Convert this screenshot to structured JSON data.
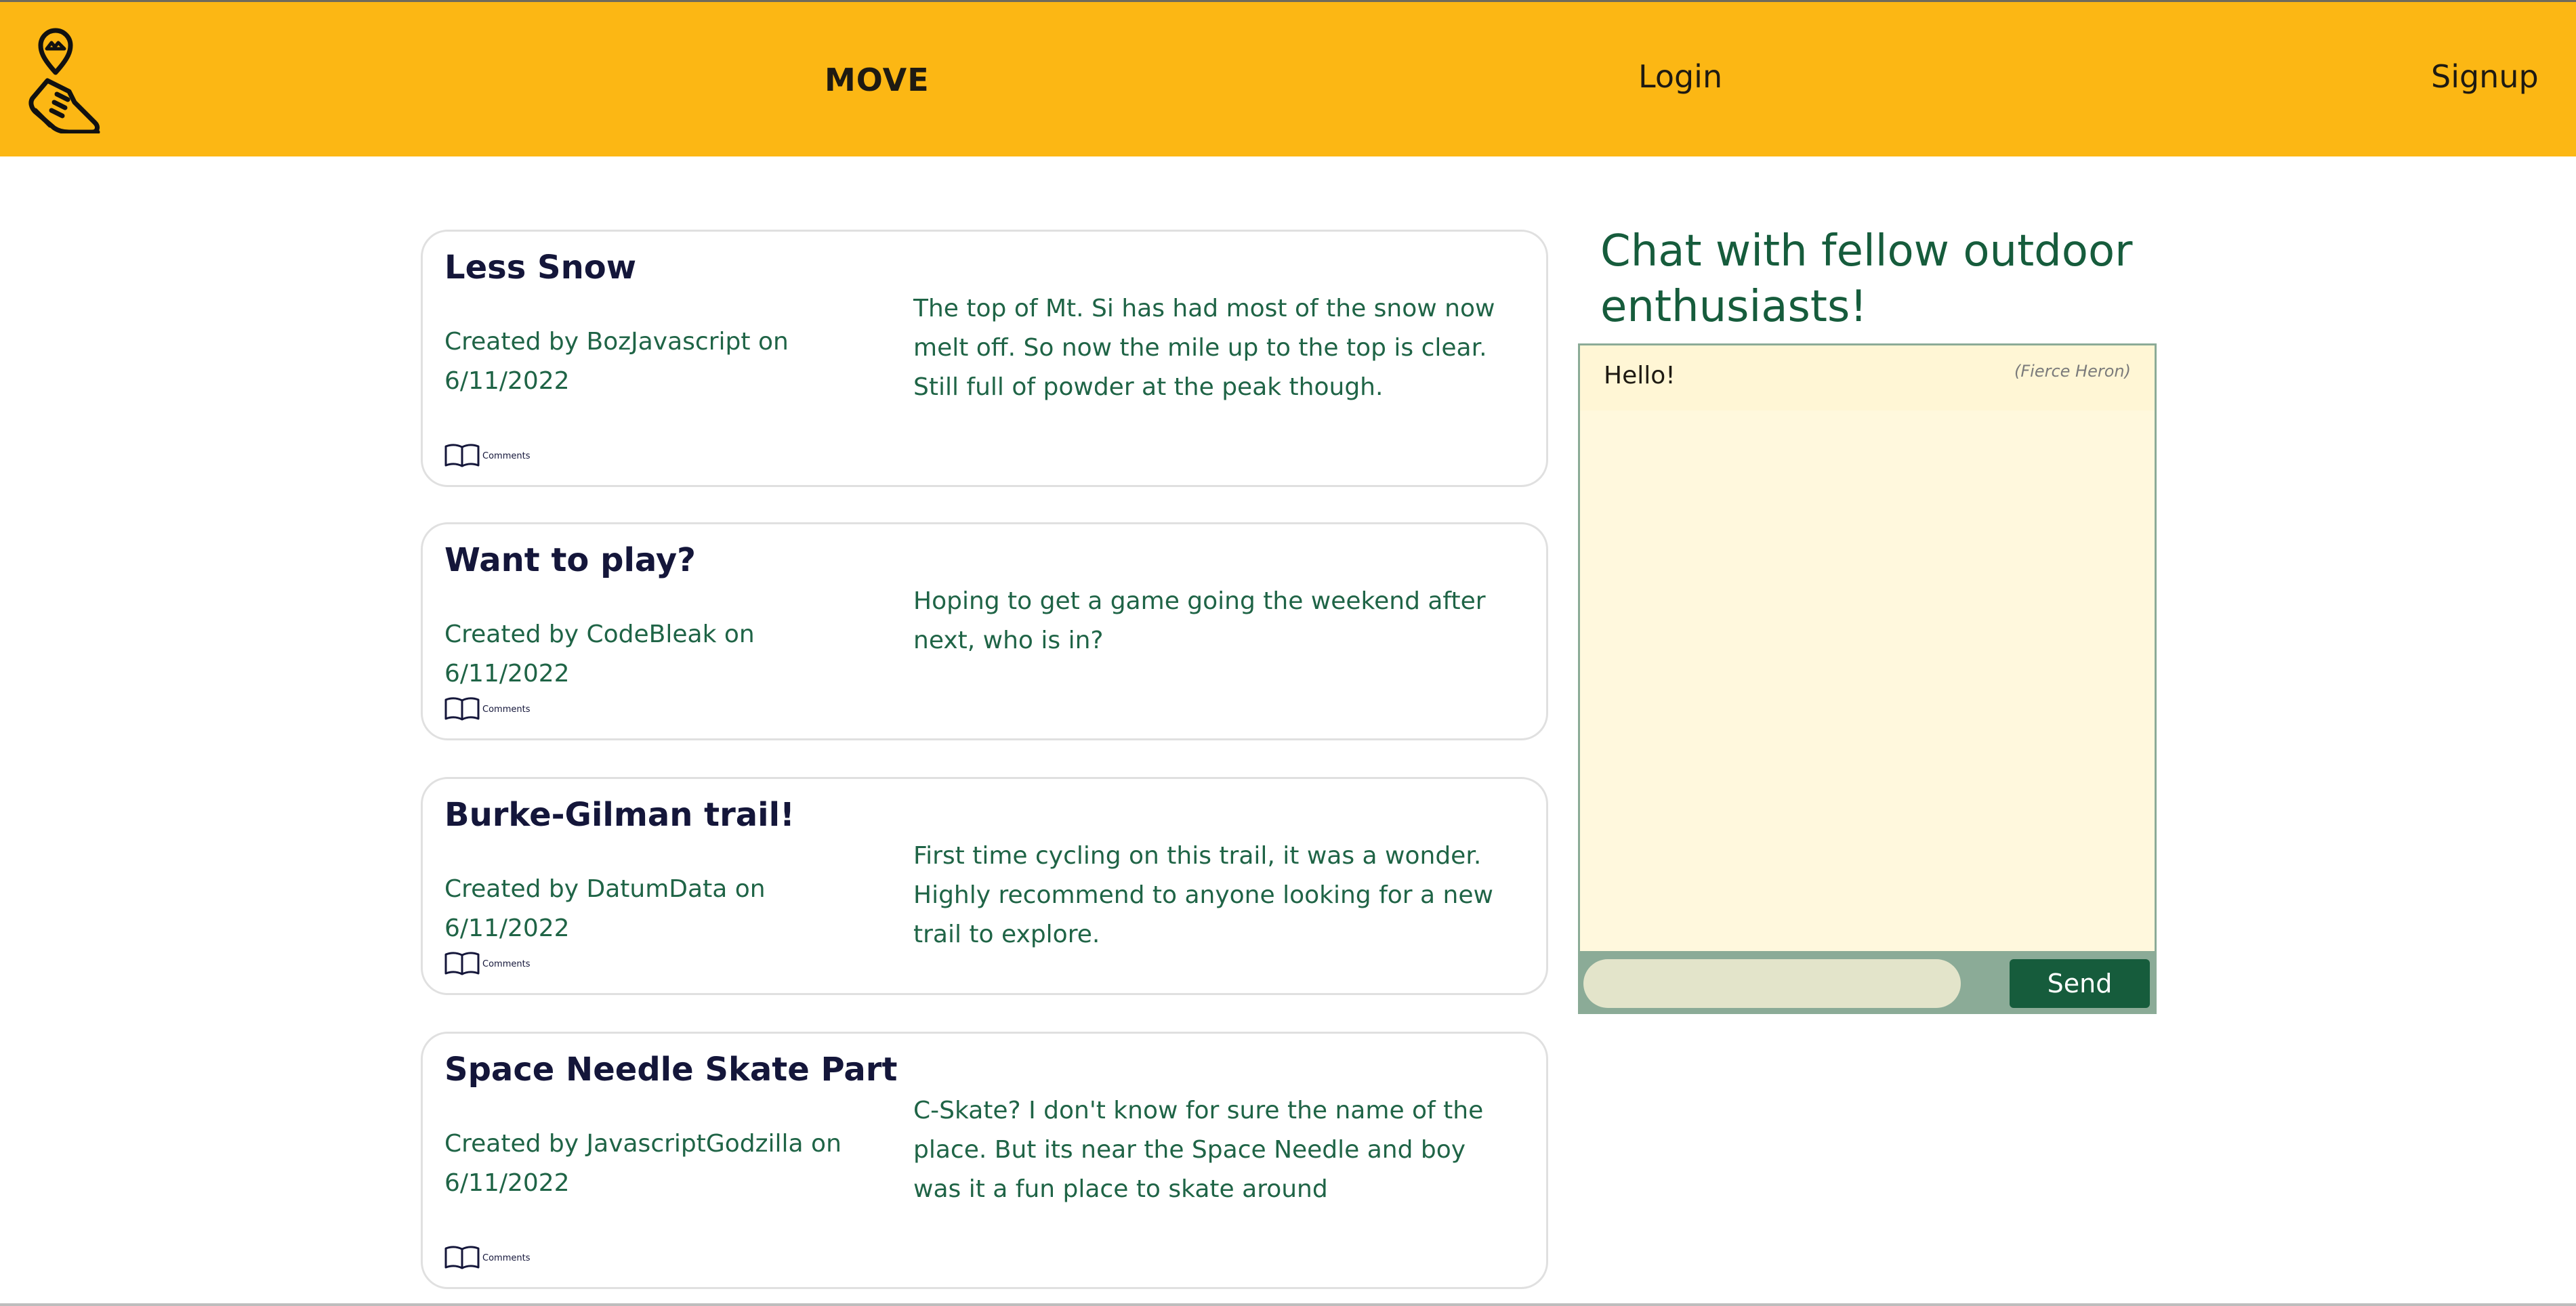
{
  "header": {
    "brand": "MOVE",
    "login_label": "Login",
    "signup_label": "Signup",
    "logo_icon": "running-shoe-location-pin-icon",
    "background_color": "#fcb714"
  },
  "posts": [
    {
      "title": "Less Snow",
      "meta": "Created by BozJavascript on 6/11/2022",
      "body": "The top of Mt. Si has had most of the snow now melt off. So now the mile up to the top is clear. Still full of powder at the peak though.",
      "comments_label": "Comments",
      "comments_icon": "open-book-icon"
    },
    {
      "title": "Want to play?",
      "meta": "Created by CodeBleak on 6/11/2022",
      "body": "Hoping to get a game going the weekend after next, who is in?",
      "comments_label": "Comments",
      "comments_icon": "open-book-icon"
    },
    {
      "title": "Burke-Gilman trail!",
      "meta": "Created by DatumData on 6/11/2022",
      "body": "First time cycling on this trail, it was a wonder. Highly recommend to anyone looking for a new trail to explore.",
      "comments_label": "Comments",
      "comments_icon": "open-book-icon"
    },
    {
      "title": "Space Needle Skate Part",
      "meta": "Created by JavascriptGodzilla on 6/11/2022",
      "body": "C-Skate? I don't know for sure the name of the place. But its near the Space Needle and boy was it a fun place to skate around",
      "comments_label": "Comments",
      "comments_icon": "open-book-icon"
    }
  ],
  "chat": {
    "heading": "Chat with fellow outdoor enthusiasts!",
    "messages": [
      {
        "text": "Hello!",
        "user": "(Fierce Heron)"
      }
    ],
    "input_value": "",
    "send_label": "Send",
    "colors": {
      "panel": "#fff8dd",
      "footer": "#8bab97",
      "button": "#165c3c"
    }
  }
}
